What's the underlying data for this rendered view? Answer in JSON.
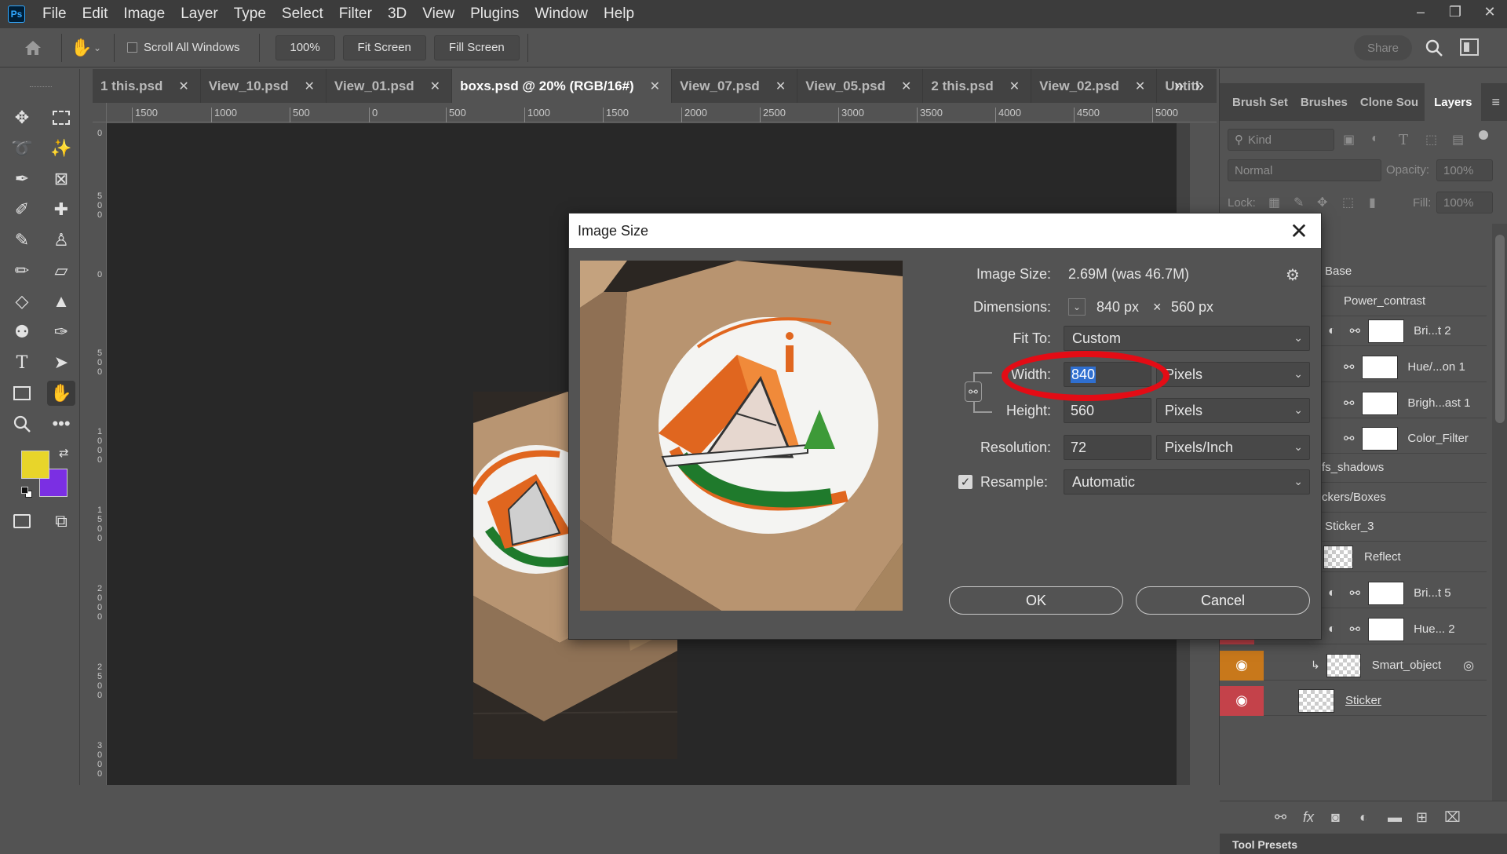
{
  "menubar": {
    "logo": "Ps",
    "items": [
      "File",
      "Edit",
      "Image",
      "Layer",
      "Type",
      "Select",
      "Filter",
      "3D",
      "View",
      "Plugins",
      "Window",
      "Help"
    ]
  },
  "options": {
    "scroll_all_windows": "Scroll All Windows",
    "zoom_100": "100%",
    "fit_screen": "Fit Screen",
    "fill_screen": "Fill Screen",
    "share": "Share"
  },
  "tabs": [
    {
      "label": "1 this.psd"
    },
    {
      "label": "View_10.psd"
    },
    {
      "label": "View_01.psd"
    },
    {
      "label": "boxs.psd @ 20% (RGB/16#)"
    },
    {
      "label": "View_07.psd"
    },
    {
      "label": "View_05.psd"
    },
    {
      "label": "2 this.psd"
    },
    {
      "label": "View_02.psd"
    },
    {
      "label": "Untitl"
    }
  ],
  "ruler": {
    "h_labels": [
      "1500",
      "1000",
      "500",
      "0",
      "500",
      "1000",
      "1500",
      "2000",
      "2500",
      "3000",
      "3500",
      "4000",
      "4500",
      "5000"
    ],
    "v_labels": [
      "0",
      "500",
      "0",
      "500",
      "1000",
      "1500",
      "2000",
      "2500",
      "3000"
    ]
  },
  "panel": {
    "tabs": [
      "Brush Set",
      "Brushes",
      "Clone Sou",
      "Layers"
    ],
    "kind_placeholder": "Kind",
    "blend_mode": "Normal",
    "opacity_label": "Opacity:",
    "opacity_value": "100%",
    "lock_label": "Lock:",
    "fill_label": "Fill:",
    "fill_value": "100%",
    "layers": [
      {
        "name": "Base"
      },
      {
        "name": "Power_contrast"
      },
      {
        "name": "Bri...t 2"
      },
      {
        "name": "Hue/...on 1"
      },
      {
        "name": "Brigh...ast 1"
      },
      {
        "name": "Color_Filter"
      },
      {
        "name": "fs_shadows"
      },
      {
        "name": "ckers/Boxes"
      },
      {
        "name": "Sticker_3"
      },
      {
        "name": "Reflect"
      },
      {
        "name": "Bri...t 5"
      },
      {
        "name": "Hue... 2"
      },
      {
        "name": "Smart_object"
      },
      {
        "name": "Sticker"
      }
    ],
    "tool_presets": "Tool Presets"
  },
  "dialog": {
    "title": "Image Size",
    "image_size_label": "Image Size:",
    "image_size_value": "2.69M (was 46.7M)",
    "dimensions_label": "Dimensions:",
    "dim_width": "840 px",
    "dim_times": "×",
    "dim_height": "560 px",
    "fit_to_label": "Fit To:",
    "fit_to_value": "Custom",
    "width_label": "Width:",
    "width_value": "840",
    "width_unit": "Pixels",
    "height_label": "Height:",
    "height_value": "560",
    "height_unit": "Pixels",
    "resolution_label": "Resolution:",
    "resolution_value": "72",
    "resolution_unit": "Pixels/Inch",
    "resample_label": "Resample:",
    "resample_value": "Automatic",
    "ok": "OK",
    "cancel": "Cancel"
  },
  "colors": {
    "foreground": "#e8d52a",
    "background": "#7b2fe3",
    "highlight": "#e30c15",
    "layer_red": "#c4424a",
    "layer_orange": "#c8781b"
  }
}
